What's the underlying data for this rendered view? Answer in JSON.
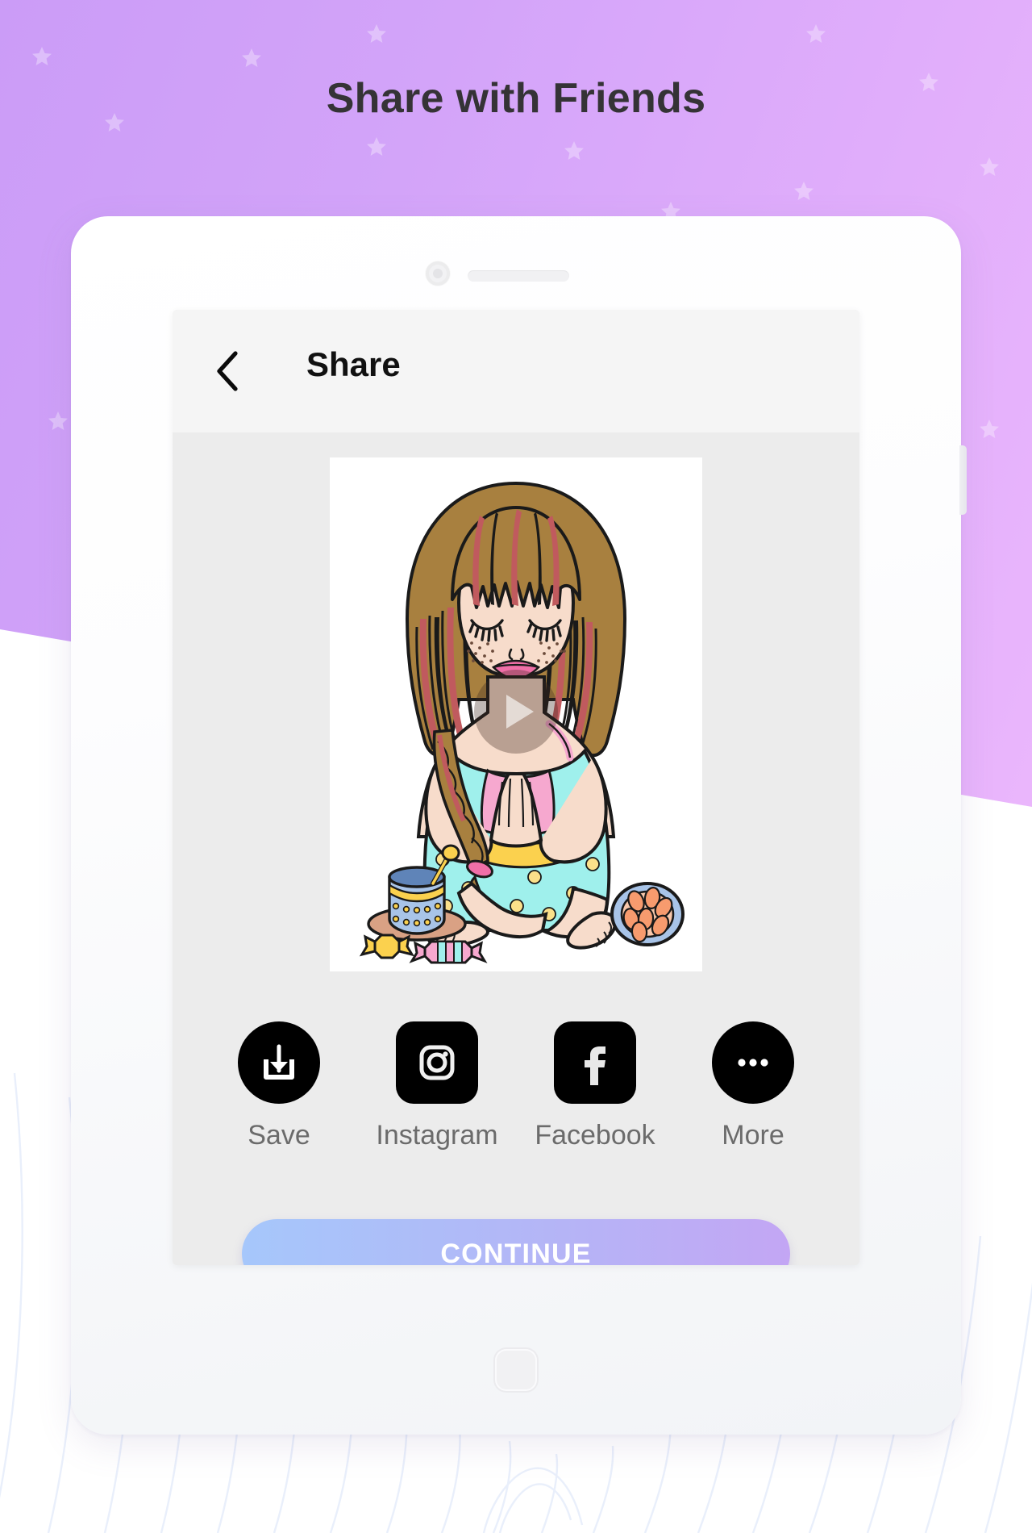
{
  "page": {
    "headline": "Share with Friends",
    "background_color_top": "#cb9cf7",
    "background_color_bottom": "#eab6fc"
  },
  "device": {
    "name": "tablet-mockup",
    "camera": "camera-icon",
    "speaker": "speaker-grille",
    "home_button": "home-button"
  },
  "appbar": {
    "back_icon": "back-chevron-icon",
    "title": "Share"
  },
  "preview": {
    "name": "artwork-preview",
    "play_icon": "play-icon",
    "alt": "Illustration of a girl with long striped brown and red hair sitting cross-legged in a blue floral dress with hands in prayer pose, next to a drum, candies and a basket of bread"
  },
  "share": {
    "items": [
      {
        "label": "Save",
        "icon": "download-icon",
        "shape": "round"
      },
      {
        "label": "Instagram",
        "icon": "instagram-icon",
        "shape": "rounded"
      },
      {
        "label": "Facebook",
        "icon": "facebook-icon",
        "shape": "rounded"
      },
      {
        "label": "More",
        "icon": "more-dots-icon",
        "shape": "round"
      }
    ]
  },
  "footer": {
    "continue_label": "CONTINUE",
    "continue_gradient_start": "#a6c7fb",
    "continue_gradient_end": "#c3a6f4"
  }
}
